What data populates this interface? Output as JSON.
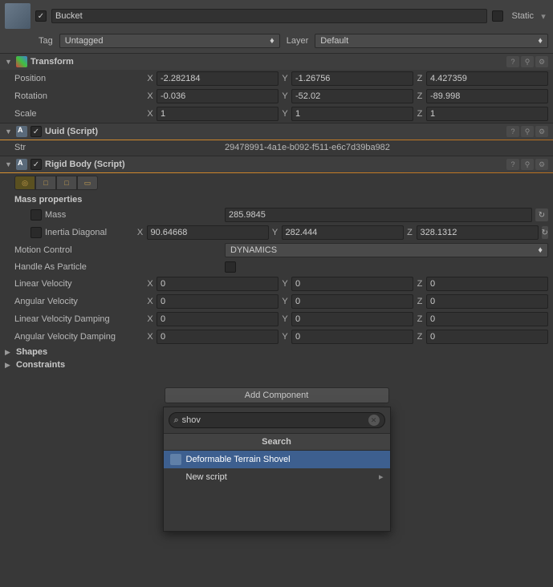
{
  "header": {
    "name": "Bucket",
    "active": true,
    "static_label": "Static",
    "static_checked": false,
    "tag_label": "Tag",
    "tag_value": "Untagged",
    "layer_label": "Layer",
    "layer_value": "Default"
  },
  "transform": {
    "title": "Transform",
    "position_label": "Position",
    "position": {
      "x": "-2.282184",
      "y": "-1.26756",
      "z": "4.427359"
    },
    "rotation_label": "Rotation",
    "rotation": {
      "x": "-0.036",
      "y": "-52.02",
      "z": "-89.998"
    },
    "scale_label": "Scale",
    "scale": {
      "x": "1",
      "y": "1",
      "z": "1"
    }
  },
  "uuid": {
    "title": "Uuid (Script)",
    "str_label": "Str",
    "str_value": "29478991-4a1e-b092-f511-e6c7d39ba982"
  },
  "rigidbody": {
    "title": "Rigid Body (Script)",
    "mass_properties_label": "Mass properties",
    "mass_label": "Mass",
    "mass_value": "285.9845",
    "inertia_label": "Inertia Diagonal",
    "inertia": {
      "x": "90.64668",
      "y": "282.444",
      "z": "328.1312"
    },
    "motion_control_label": "Motion Control",
    "motion_control_value": "DYNAMICS",
    "handle_as_particle_label": "Handle As Particle",
    "linear_velocity_label": "Linear Velocity",
    "linear_velocity": {
      "x": "0",
      "y": "0",
      "z": "0"
    },
    "angular_velocity_label": "Angular Velocity",
    "angular_velocity": {
      "x": "0",
      "y": "0",
      "z": "0"
    },
    "linear_damping_label": "Linear Velocity Damping",
    "linear_damping": {
      "x": "0",
      "y": "0",
      "z": "0"
    },
    "angular_damping_label": "Angular Velocity Damping",
    "angular_damping": {
      "x": "0",
      "y": "0",
      "z": "0"
    },
    "shapes_label": "Shapes",
    "constraints_label": "Constraints"
  },
  "axis": {
    "x": "X",
    "y": "Y",
    "z": "Z"
  },
  "add_component": {
    "button_label": "Add Component",
    "search_value": "shov",
    "search_header": "Search",
    "results": [
      {
        "label": "Deformable Terrain Shovel",
        "selected": true,
        "has_icon": true
      },
      {
        "label": "New script",
        "selected": false,
        "has_chevron": true
      }
    ]
  }
}
